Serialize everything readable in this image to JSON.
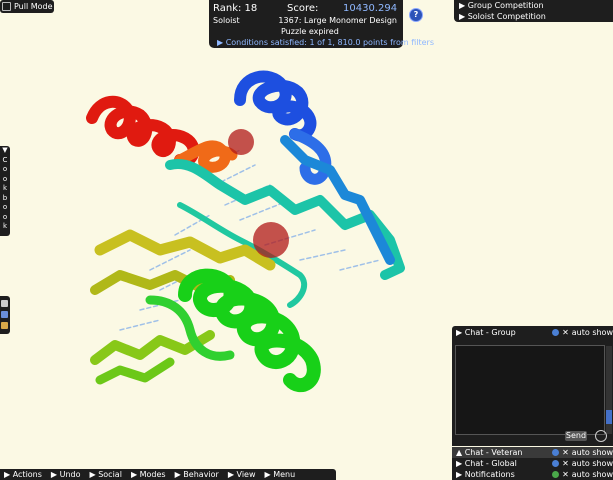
{
  "top_left": {
    "pull_mode_label": "Pull Mode"
  },
  "score_panel": {
    "rank": "Rank: 18",
    "score_label": "Score:",
    "score_value": "10430.294",
    "mode": "Soloist",
    "puzzle": "1367: Large Monomer Design",
    "status": "Puzzle expired",
    "conditions": "▶ Conditions satisfied: 1 of 1, 810.0 points from filters"
  },
  "help_icon": "?",
  "competitions": [
    "▶ Group Competition",
    "▶ Soloist Competition"
  ],
  "cookbook": {
    "arrow": "▼",
    "letters": [
      "C",
      "o",
      "o",
      "k",
      "b",
      "o",
      "o",
      "k"
    ]
  },
  "chat": {
    "group_title": "▶  Chat - Group",
    "auto_show": "auto show",
    "send_label": "Send",
    "rows": [
      {
        "title": "▲  Chat - Veteran",
        "icon": "info"
      },
      {
        "title": "▶  Chat - Global",
        "icon": "info"
      },
      {
        "title": "▶  Notifications",
        "icon": "info-green"
      }
    ]
  },
  "bottom_menu": [
    "▶ Actions",
    "▶ Undo",
    "▶ Social",
    "▶ Modes",
    "▶ Behavior",
    "▶ View",
    "▶ Menu"
  ],
  "colors": {
    "panel": "#1e1e1e",
    "background": "#fbf9e4",
    "accent": "#8fb8ff"
  }
}
